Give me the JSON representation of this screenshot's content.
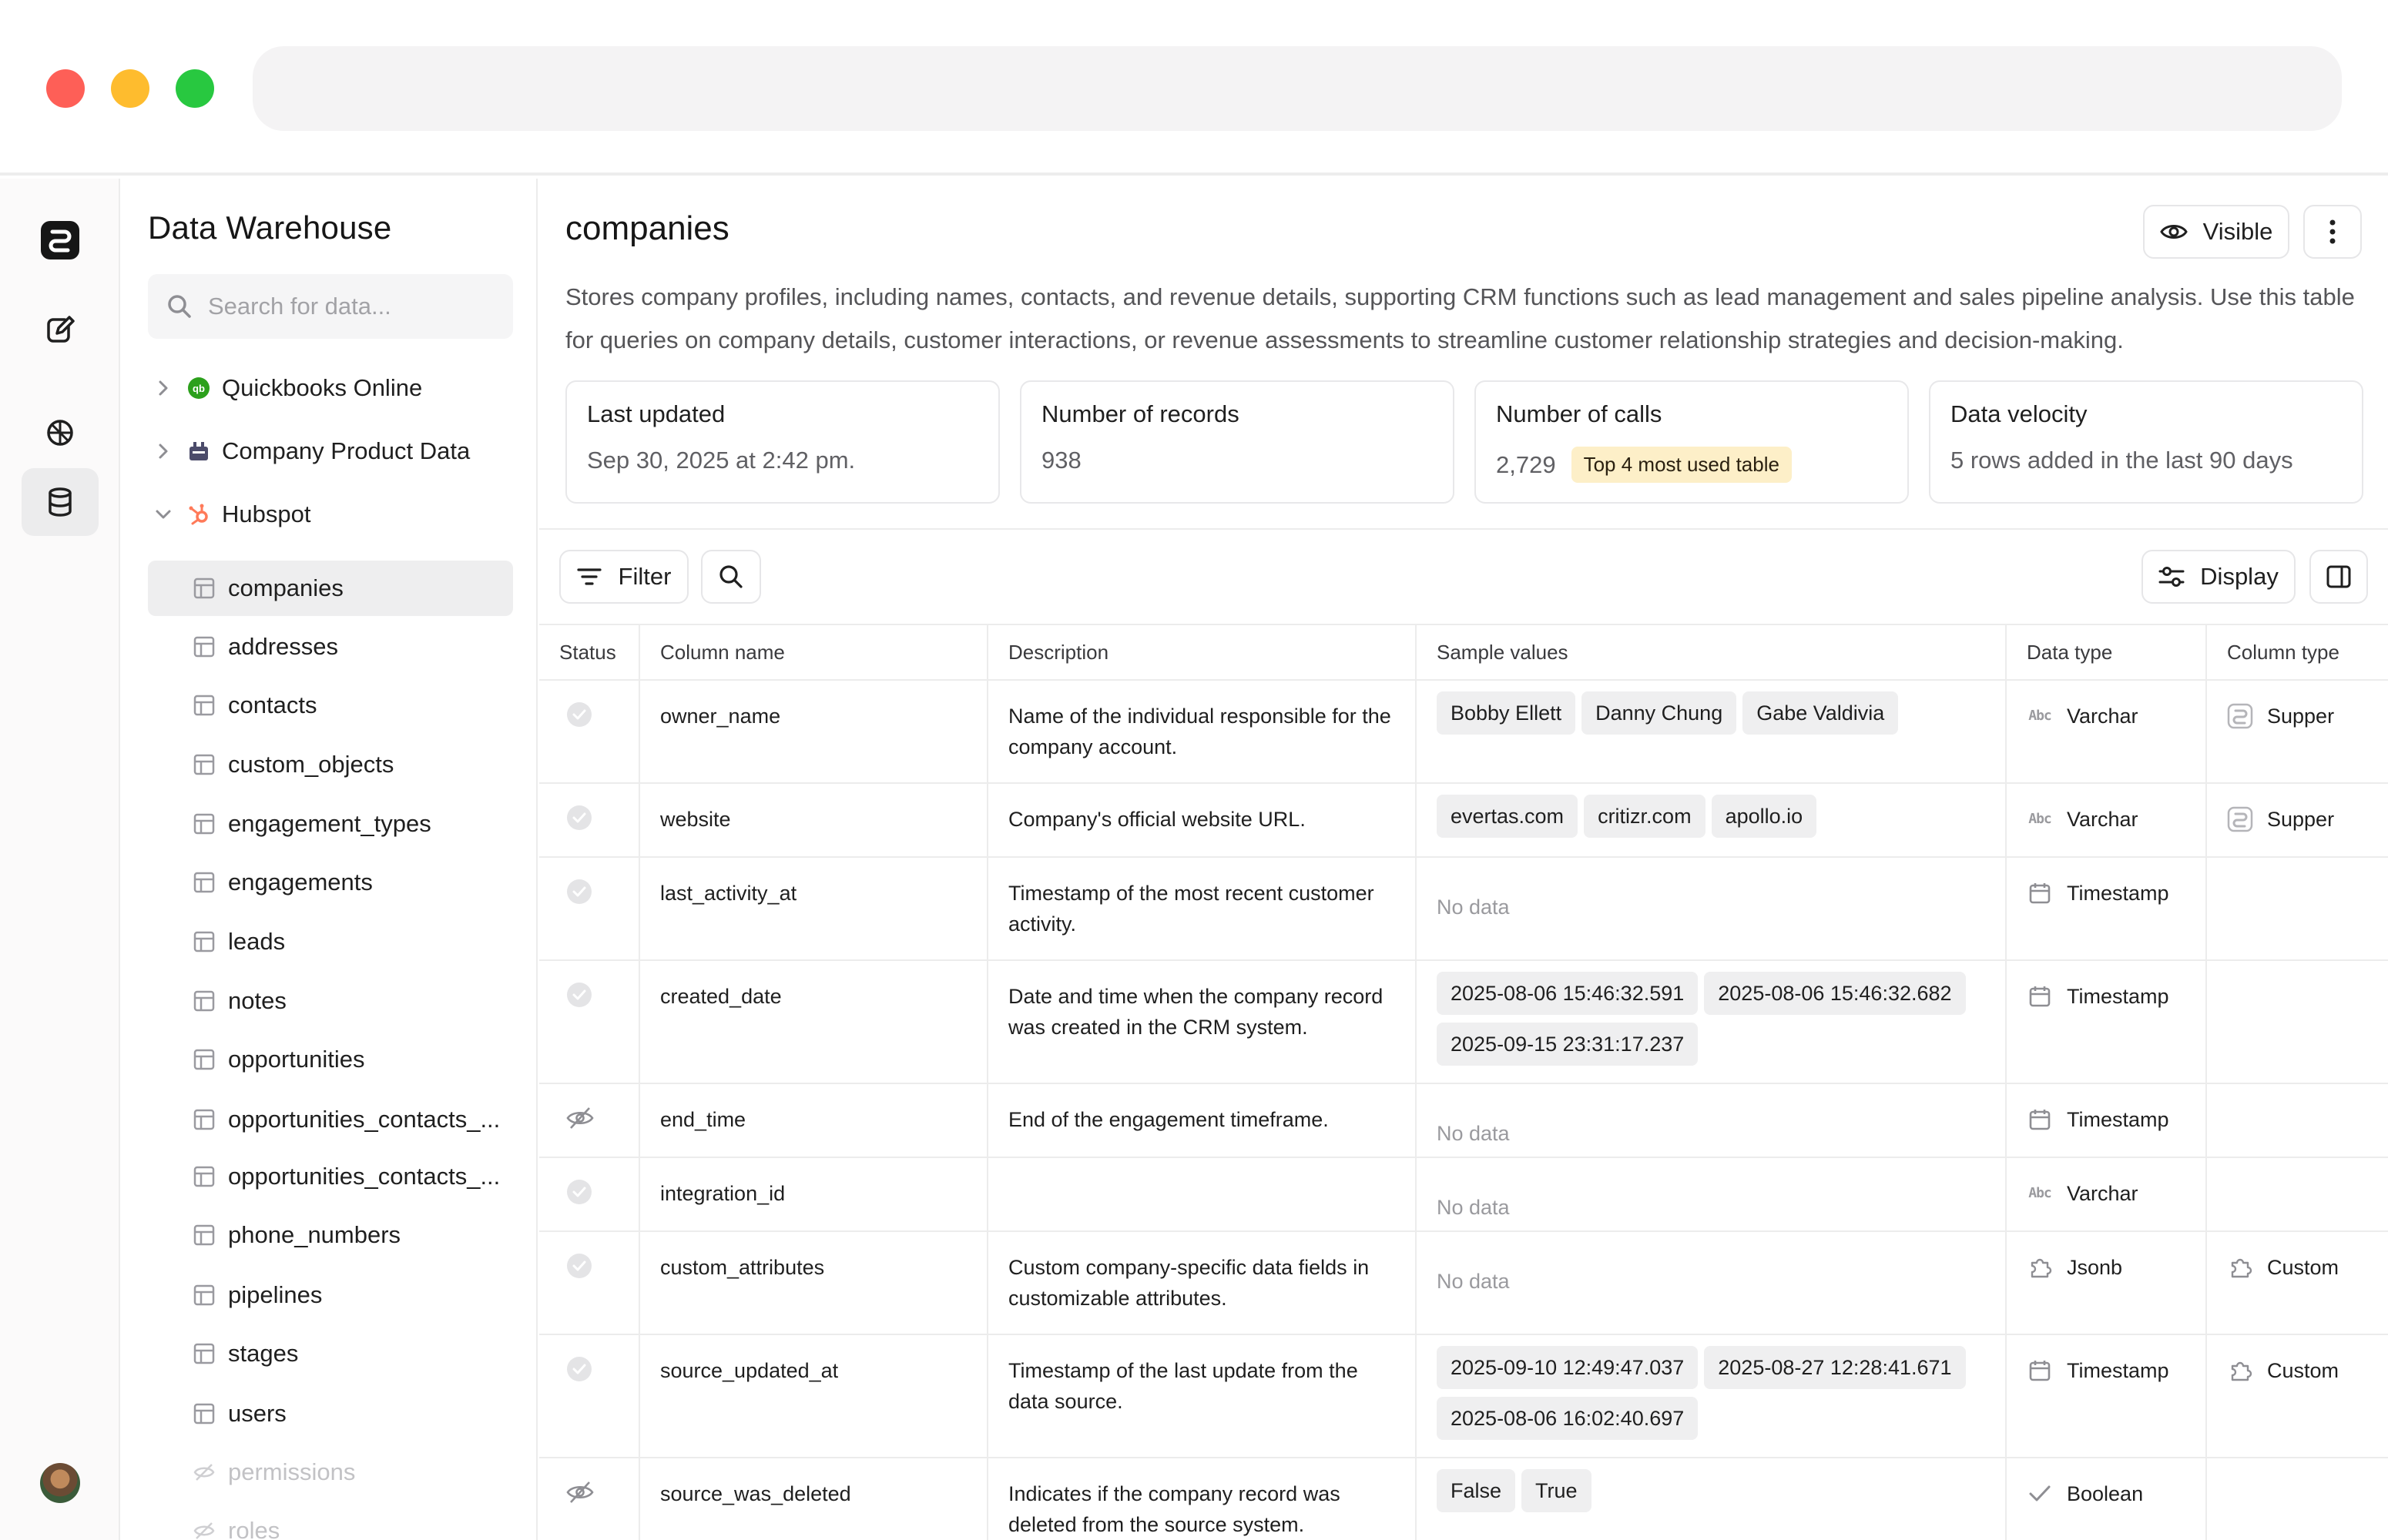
{
  "window": {
    "url": ""
  },
  "rail": {
    "items": [
      "logo",
      "compose",
      "integrations",
      "database"
    ],
    "active": "database"
  },
  "sidebar": {
    "title": "Data Warehouse",
    "search_placeholder": "Search for data...",
    "sources": [
      {
        "label": "Quickbooks Online",
        "expanded": false
      },
      {
        "label": "Company Product Data",
        "expanded": false
      },
      {
        "label": "Hubspot",
        "expanded": true
      }
    ],
    "tables": [
      "companies",
      "addresses",
      "contacts",
      "custom_objects",
      "engagement_types",
      "engagements",
      "leads",
      "notes",
      "opportunities",
      "opportunities_contacts_...",
      "opportunities_contacts_...",
      "phone_numbers",
      "pipelines",
      "stages",
      "users",
      "permissions",
      "roles"
    ],
    "selected_table": "companies"
  },
  "main": {
    "title": "companies",
    "visible_label": "Visible",
    "description": "Stores company profiles, including names, contacts, and revenue details, supporting CRM functions such as lead management and sales pipeline analysis. Use this table for queries on company details, customer interactions, or revenue assessments to streamline customer relationship strategies and decision-making.",
    "stats": [
      {
        "label": "Last updated",
        "value": "Sep 30, 2025 at 2:42 pm."
      },
      {
        "label": "Number of records",
        "value": "938"
      },
      {
        "label": "Number of calls",
        "value": "2,729",
        "badge": "Top 4 most used table"
      },
      {
        "label": "Data velocity",
        "value": "5 rows added in the last 90 days"
      }
    ],
    "filter_label": "Filter",
    "display_label": "Display",
    "columns": [
      "Status",
      "Column name",
      "Description",
      "Sample values",
      "Data type",
      "Column type"
    ],
    "rows": [
      {
        "status": "active",
        "name": "owner_name",
        "description": "Name of the individual responsible for the company account.",
        "samples": [
          "Bobby Ellett",
          "Danny Chung",
          "Gabe Valdivia"
        ],
        "dtype": "Varchar",
        "dtype_icon": "abc",
        "ctype": "Supper",
        "ctype_icon": "supper"
      },
      {
        "status": "active",
        "name": "website",
        "description": "Company's official website URL.",
        "samples": [
          "evertas.com",
          "critizr.com",
          "apollo.io"
        ],
        "dtype": "Varchar",
        "dtype_icon": "abc",
        "ctype": "Supper",
        "ctype_icon": "supper"
      },
      {
        "status": "active",
        "name": "last_activity_at",
        "description": "Timestamp of the most recent customer activity.",
        "samples": [],
        "nodata": "No data",
        "dtype": "Timestamp",
        "dtype_icon": "calendar",
        "ctype": "",
        "ctype_icon": ""
      },
      {
        "status": "active",
        "name": "created_date",
        "description": "Date and time when the company record was created in the CRM system.",
        "samples": [
          "2025-08-06 15:46:32.591",
          "2025-08-06 15:46:32.682",
          "2025-09-15 23:31:17.237"
        ],
        "dtype": "Timestamp",
        "dtype_icon": "calendar",
        "ctype": "",
        "ctype_icon": ""
      },
      {
        "status": "hidden",
        "name": "end_time",
        "description": "End of the engagement timeframe.",
        "samples": [],
        "nodata": "No data",
        "dtype": "Timestamp",
        "dtype_icon": "calendar",
        "ctype": "",
        "ctype_icon": ""
      },
      {
        "status": "active",
        "name": "integration_id",
        "description": "",
        "samples": [],
        "nodata": "No data",
        "dtype": "Varchar",
        "dtype_icon": "abc",
        "ctype": "",
        "ctype_icon": ""
      },
      {
        "status": "active",
        "name": "custom_attributes",
        "description": "Custom company-specific data fields in customizable attributes.",
        "samples": [],
        "nodata": "No data",
        "dtype": "Jsonb",
        "dtype_icon": "puzzle",
        "ctype": "Custom",
        "ctype_icon": "puzzle"
      },
      {
        "status": "active",
        "name": "source_updated_at",
        "description": "Timestamp of the last update from the data source.",
        "samples": [
          "2025-09-10 12:49:47.037",
          "2025-08-27 12:28:41.671",
          "2025-08-06 16:02:40.697"
        ],
        "dtype": "Timestamp",
        "dtype_icon": "calendar",
        "ctype": "Custom",
        "ctype_icon": "puzzle"
      },
      {
        "status": "hidden",
        "name": "source_was_deleted",
        "description": "Indicates if the company record was deleted from the source system.",
        "samples": [
          "False",
          "True"
        ],
        "dtype": "Boolean",
        "dtype_icon": "check",
        "ctype": "",
        "ctype_icon": ""
      }
    ]
  }
}
